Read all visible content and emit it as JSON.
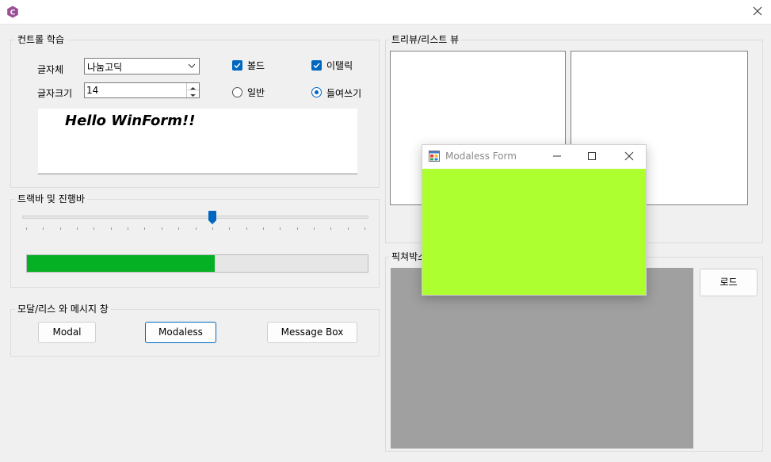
{
  "window": {
    "close_label": "✕"
  },
  "controls_group": {
    "title": "컨트롤 학습",
    "font_label": "글자체",
    "font_value": "나눔고딕",
    "size_label": "글자크기",
    "size_value": "14",
    "bold_label": "볼드",
    "italic_label": "이탤릭",
    "normal_label": "일반",
    "indent_label": "들여쓰기",
    "bold_checked": true,
    "italic_checked": true,
    "selected_radio": "indent",
    "preview_text": "Hello WinForm!!"
  },
  "trackbar_group": {
    "title": "트랙바 및 진행바",
    "trackbar_value": 0.55,
    "progress_value": 0.55
  },
  "dialog_group": {
    "title": "모달/리스 와 메시지 창",
    "modal_button": "Modal",
    "modaless_button": "Modaless",
    "messagebox_button": "Message Box"
  },
  "treelist_group": {
    "title": "트리뷰/리스트 뷰"
  },
  "picture_group": {
    "title": "픽쳐박스",
    "load_button": "로드"
  },
  "modaless_form": {
    "title": "Modaless Form",
    "background": "#adff2f"
  },
  "colors": {
    "accent": "#0067c0",
    "progress": "#06b025",
    "picturebox": "#a0a0a0"
  }
}
